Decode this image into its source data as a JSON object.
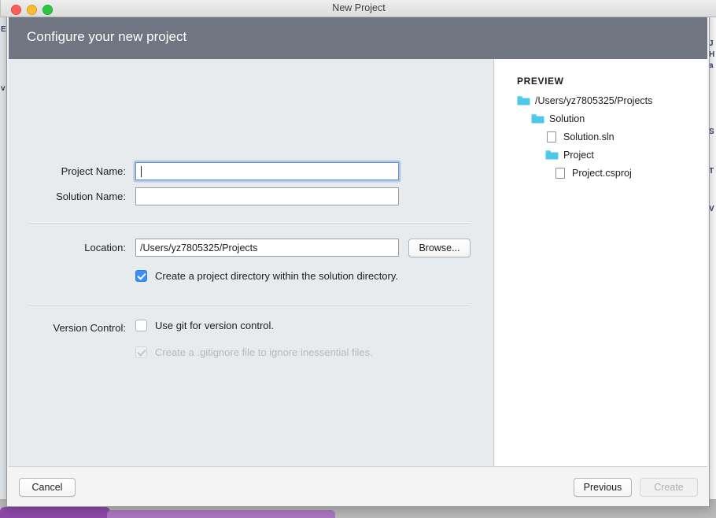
{
  "window": {
    "title": "New Project",
    "traffic_lights": [
      "close-button",
      "minimize-button",
      "maximize-button"
    ]
  },
  "header": {
    "title": "Configure your new project",
    "background_color": "#6f7682"
  },
  "form": {
    "project_name": {
      "label": "Project Name:",
      "value": "",
      "placeholder": "",
      "focused": true
    },
    "solution_name": {
      "label": "Solution Name:",
      "value": "",
      "placeholder": "",
      "focused": false
    },
    "location": {
      "label": "Location:",
      "value": "/Users/yz7805325/Projects",
      "placeholder": "",
      "browse_label": "Browse..."
    },
    "project_directory_checkbox": {
      "label": "Create a project directory within the solution directory.",
      "checked": true,
      "enabled": true
    },
    "version_control": {
      "label": "Version Control:",
      "use_git": {
        "label": "Use git for version control.",
        "checked": false,
        "enabled": true
      },
      "gitignore": {
        "label": "Create a .gitignore file to ignore inessential files.",
        "checked": true,
        "enabled": false
      }
    }
  },
  "preview": {
    "title": "PREVIEW",
    "folder_color": "#4ec8e8",
    "tree": [
      {
        "label": "/Users/yz7805325/Projects",
        "type": "folder",
        "depth": 0
      },
      {
        "label": "Solution",
        "type": "folder",
        "depth": 1
      },
      {
        "label": "Solution.sln",
        "type": "file",
        "depth": 2
      },
      {
        "label": "Project",
        "type": "folder",
        "depth": 2
      },
      {
        "label": "Project.csproj",
        "type": "file",
        "depth": 3
      }
    ]
  },
  "footer": {
    "cancel_label": "Cancel",
    "previous_label": "Previous",
    "create_label": "Create",
    "create_enabled": false
  },
  "background": {
    "left_glyphs": [
      "E",
      "v"
    ],
    "right_glyphs": [
      "J",
      "H",
      "a",
      "S",
      "T",
      "V"
    ]
  }
}
